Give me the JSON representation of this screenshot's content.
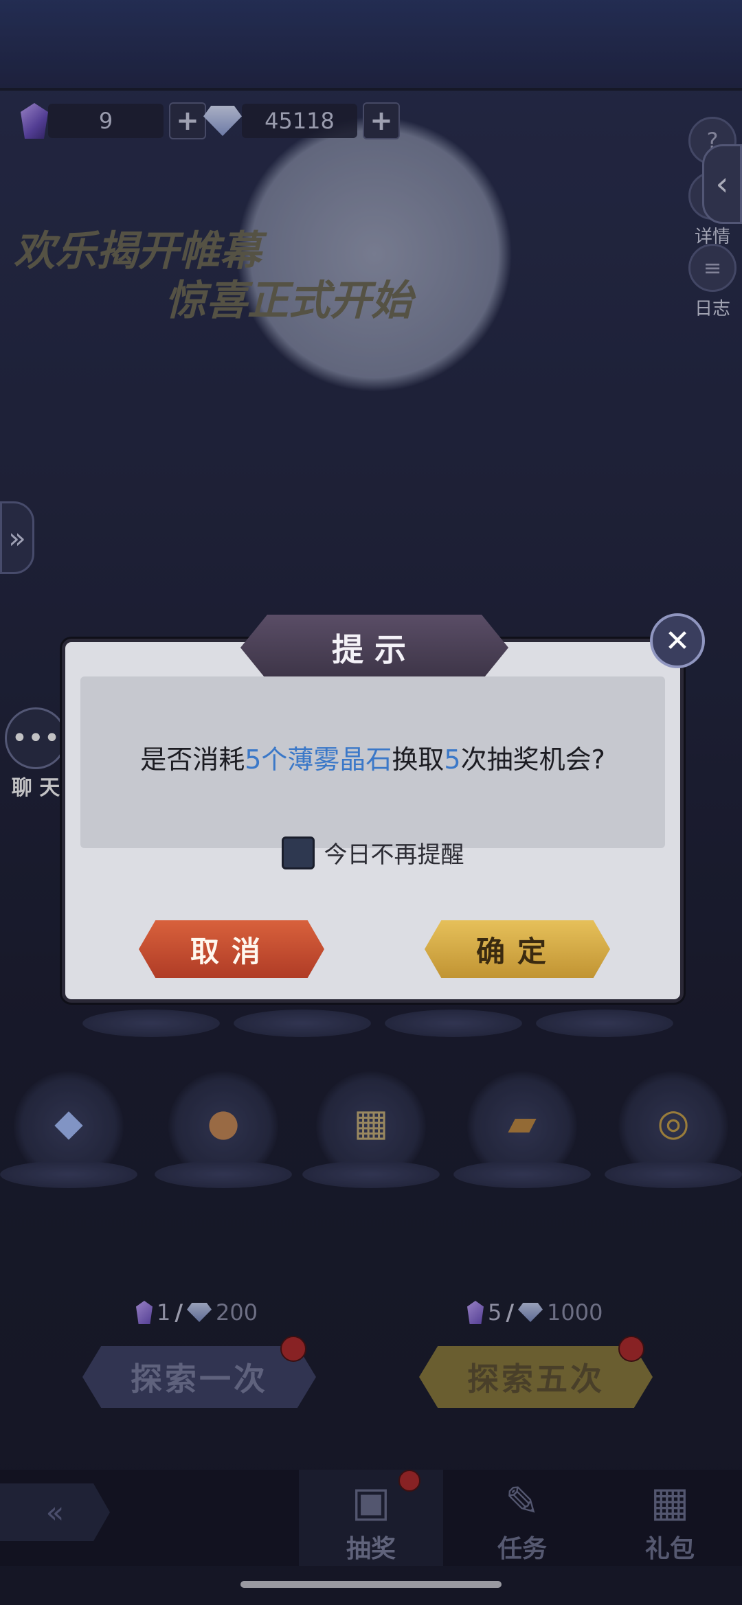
{
  "resources": {
    "crystal_count": "9",
    "diamond_count": "45118",
    "plus_symbol": "+"
  },
  "banner": {
    "line1": "欢乐揭开帷幕",
    "line2": "惊喜正式开始"
  },
  "side_menu": {
    "details_label": "详情",
    "log_label": "日志"
  },
  "chat": {
    "label": "聊 天"
  },
  "dialog": {
    "title": "提示",
    "message_prefix": "是否消耗",
    "message_highlight1": "5个薄雾晶石",
    "message_middle": "换取",
    "message_highlight2": "5",
    "message_suffix": "次抽奖机会?",
    "checkbox_label": "今日不再提醒",
    "cancel_label": "取消",
    "confirm_label": "确定",
    "close_symbol": "✕",
    "highlight_color": "#3b78c8"
  },
  "prizes": {
    "row2_icons": [
      "diamond-icon",
      "orb-icon",
      "gift-box-icon",
      "gold-chest-icon",
      "coins-icon"
    ]
  },
  "explore": {
    "once": {
      "crystal_cost": "1",
      "diamond_cost": "200",
      "label": "探索一次"
    },
    "five": {
      "crystal_cost": "5",
      "diamond_cost": "1000",
      "label": "探索五次"
    }
  },
  "bottom_nav": {
    "tabs": [
      {
        "label": "抽奖",
        "icon": "cards-icon",
        "active": true
      },
      {
        "label": "任务",
        "icon": "scroll-icon",
        "active": false
      },
      {
        "label": "礼包",
        "icon": "gift-icon",
        "active": false
      }
    ]
  }
}
